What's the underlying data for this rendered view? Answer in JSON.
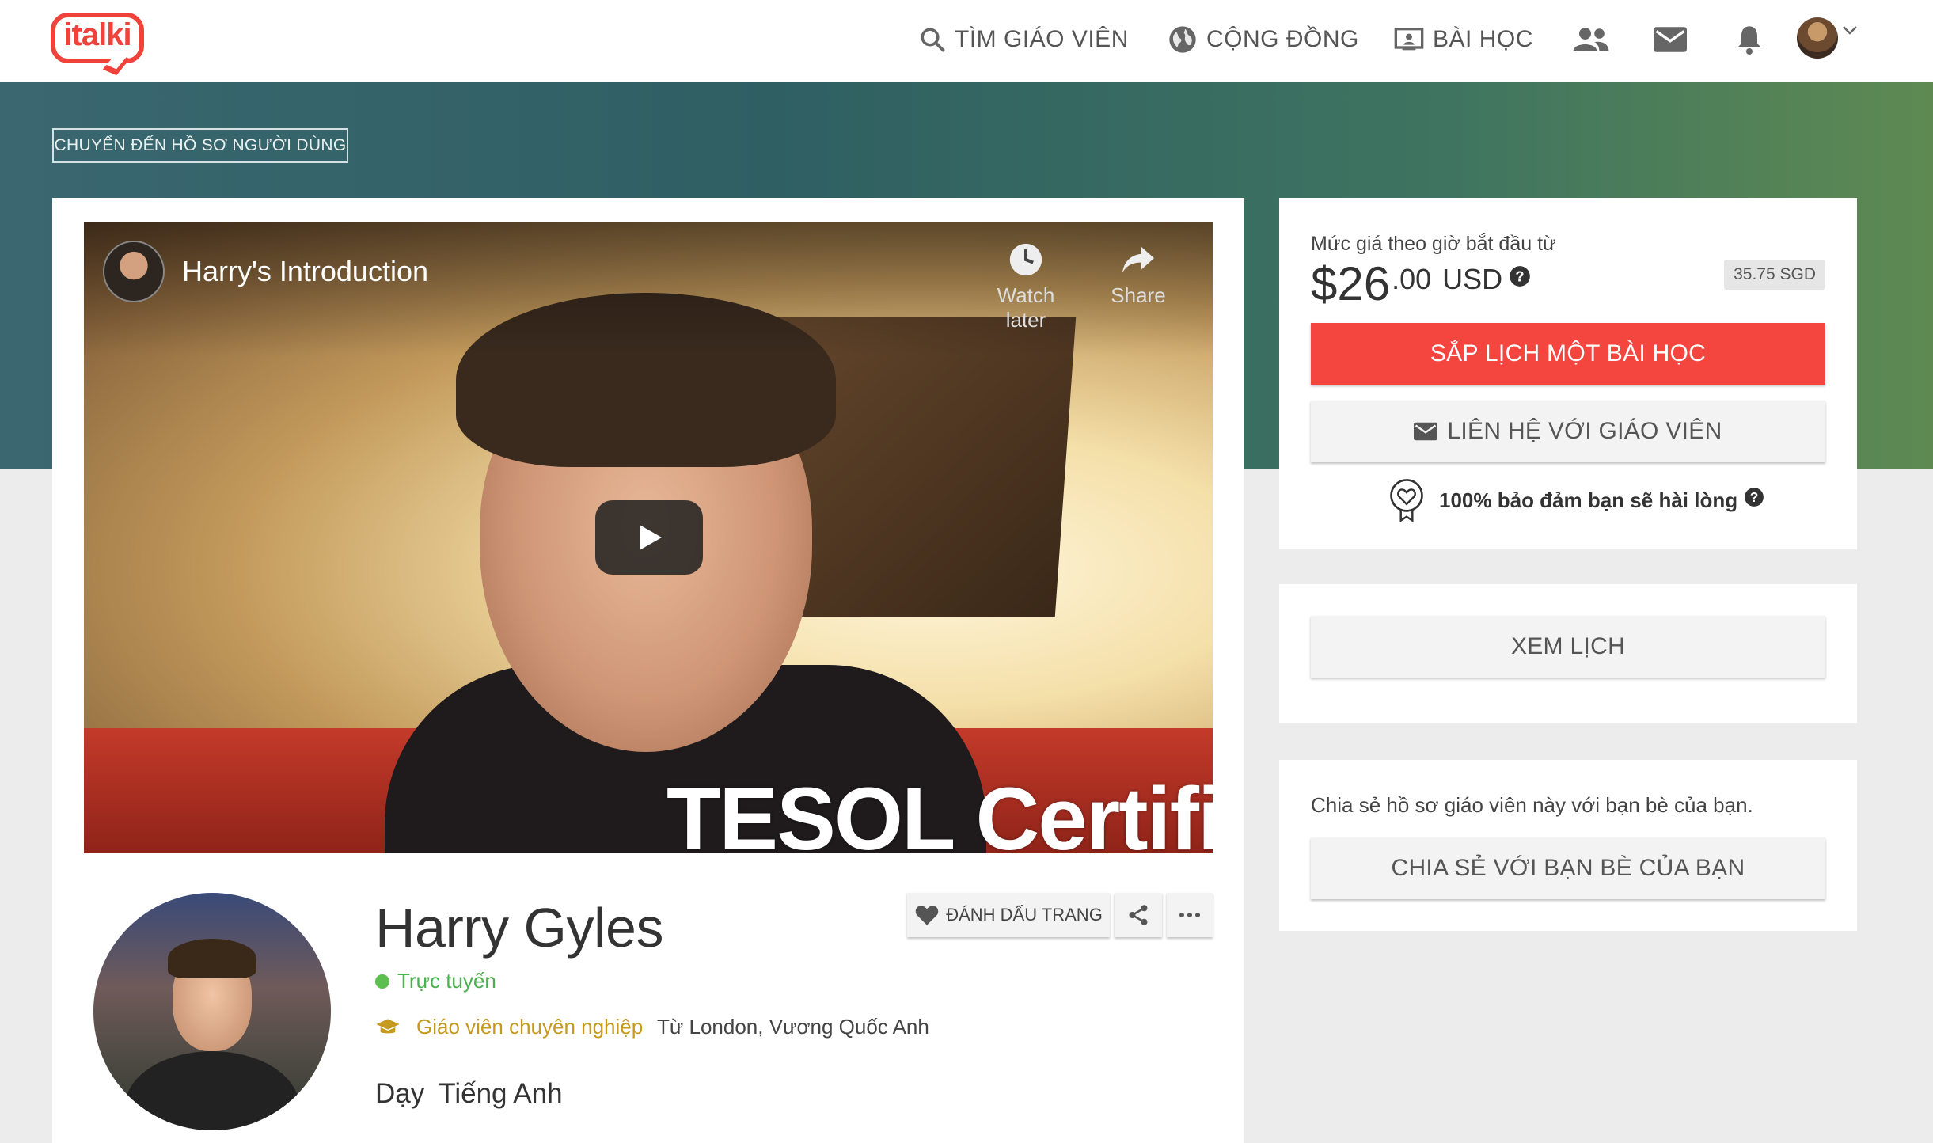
{
  "brand": {
    "logo_text": "italki",
    "accent": "#f0423a"
  },
  "nav": {
    "find_teacher": "TÌM GIÁO VIÊN",
    "community": "CỘNG ĐỒNG",
    "lessons": "BÀI HỌC"
  },
  "hero": {
    "goto_profile": "CHUYỂN ĐẾN HỒ SƠ NGƯỜI DÙNG"
  },
  "video": {
    "title": "Harry's Introduction",
    "watch_later": "Watch later",
    "share": "Share",
    "caption": "TESOL Certifi"
  },
  "teacher": {
    "name": "Harry Gyles",
    "status": "Trực tuyến",
    "type": "Giáo viên chuyên nghiệp",
    "from": "Từ London, Vương Quốc Anh",
    "teaches_label": "Dạy",
    "teaches_language": "Tiếng Anh"
  },
  "actions": {
    "bookmark": "ĐÁNH DẤU TRANG"
  },
  "pricing": {
    "label": "Mức giá theo giờ bắt đầu từ",
    "dollars": "$26",
    "cents": ".00",
    "currency": "USD",
    "alt_price": "35.75 SGD",
    "book_button": "SẮP LỊCH MỘT BÀI HỌC",
    "contact_button": "LIÊN HỆ VỚI GIÁO VIÊN",
    "guarantee": "100% bảo đảm bạn sẽ hài lòng"
  },
  "schedule": {
    "view_button": "XEM LỊCH"
  },
  "share": {
    "text": "Chia sẻ hồ sơ giáo viên này với bạn bè của bạn.",
    "button": "CHIA SẺ VỚI BẠN BÈ CỦA BẠN"
  },
  "colors": {
    "book_red": "#f4453f",
    "online_green": "#5cbf50",
    "pro_gold": "#c59a1e"
  }
}
